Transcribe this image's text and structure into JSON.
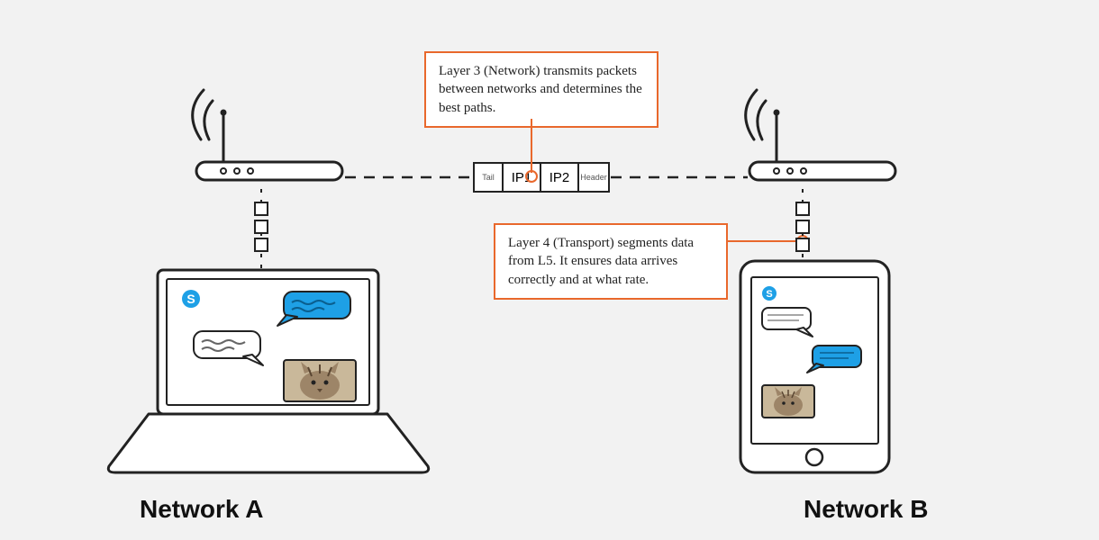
{
  "callouts": {
    "layer3": "Layer 3 (Network) transmits packets between networks and determines the best paths.",
    "layer4": "Layer 4 (Transport) segments data from L5. It ensures data arrives correctly and at what rate."
  },
  "packet": {
    "tail": "Tail",
    "ip1": "IP1",
    "ip2": "IP2",
    "header": "Header"
  },
  "labels": {
    "networkA": "Network A",
    "networkB": "Network B"
  },
  "colors": {
    "accent": "#e9682c",
    "bubbleBlue": "#1ea0e6",
    "skype": "#1ea0e6"
  }
}
